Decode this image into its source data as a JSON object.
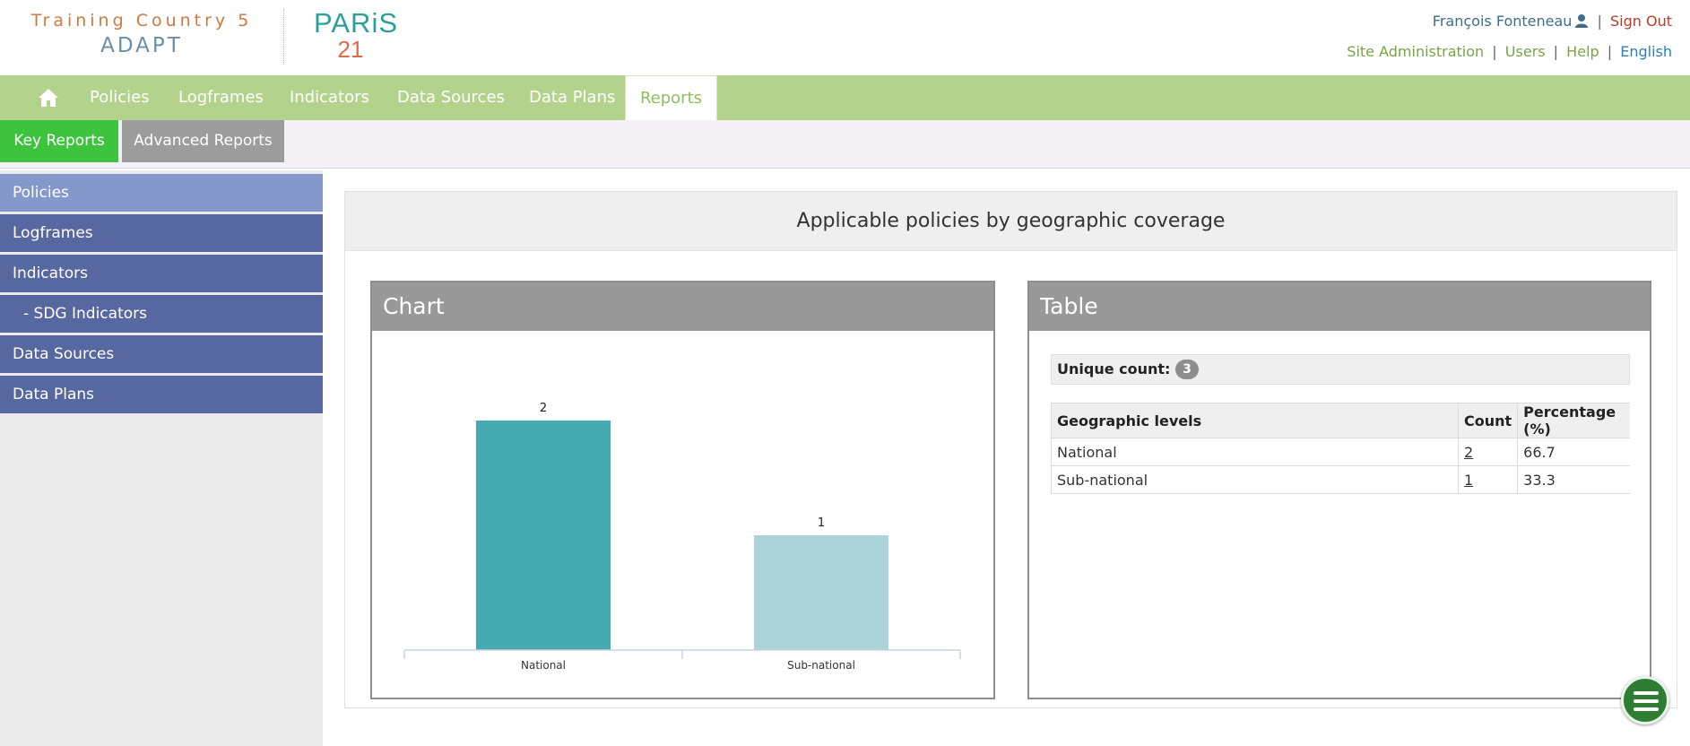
{
  "header": {
    "country": "Training Country 5",
    "product": "ADAPT",
    "partner_logo_word": "PARiS",
    "partner_logo_num": "21",
    "user_name": "François Fonteneau",
    "sign_out": "Sign Out",
    "links": [
      "Site Administration",
      "Users",
      "Help"
    ],
    "language": "English",
    "separator": "|"
  },
  "topnav": {
    "items": [
      "Policies",
      "Logframes",
      "Indicators",
      "Data Sources",
      "Data Plans",
      "Reports"
    ],
    "active": "Reports"
  },
  "subnav": {
    "tabs": [
      "Key Reports",
      "Advanced Reports"
    ],
    "active": "Key Reports"
  },
  "sidebar": {
    "items": [
      "Policies",
      "Logframes",
      "Indicators",
      "- SDG Indicators",
      "Data Sources",
      "Data Plans"
    ],
    "active": "Policies"
  },
  "report": {
    "title": "Applicable policies by geographic coverage",
    "chart_panel_title": "Chart",
    "table_panel_title": "Table",
    "unique_label": "Unique count:",
    "unique_count": "3",
    "table": {
      "headers": [
        "Geographic levels",
        "Count",
        "Percentage (%)"
      ],
      "rows": [
        [
          "National",
          "2",
          "66.7"
        ],
        [
          "Sub-national",
          "1",
          "33.3"
        ]
      ]
    }
  },
  "chart_data": {
    "type": "bar",
    "categories": [
      "National",
      "Sub-national"
    ],
    "values": [
      2,
      1
    ],
    "colors": [
      "#45abb1",
      "#acd4d8"
    ],
    "ylim": [
      0,
      2
    ]
  },
  "colors": {
    "nav_green": "#b3d38d",
    "key_reports_green": "#3ec33e",
    "sidebar_blue": "#5768a0",
    "sidebar_active": "#8598cc",
    "panel_header_gray": "#999999"
  }
}
